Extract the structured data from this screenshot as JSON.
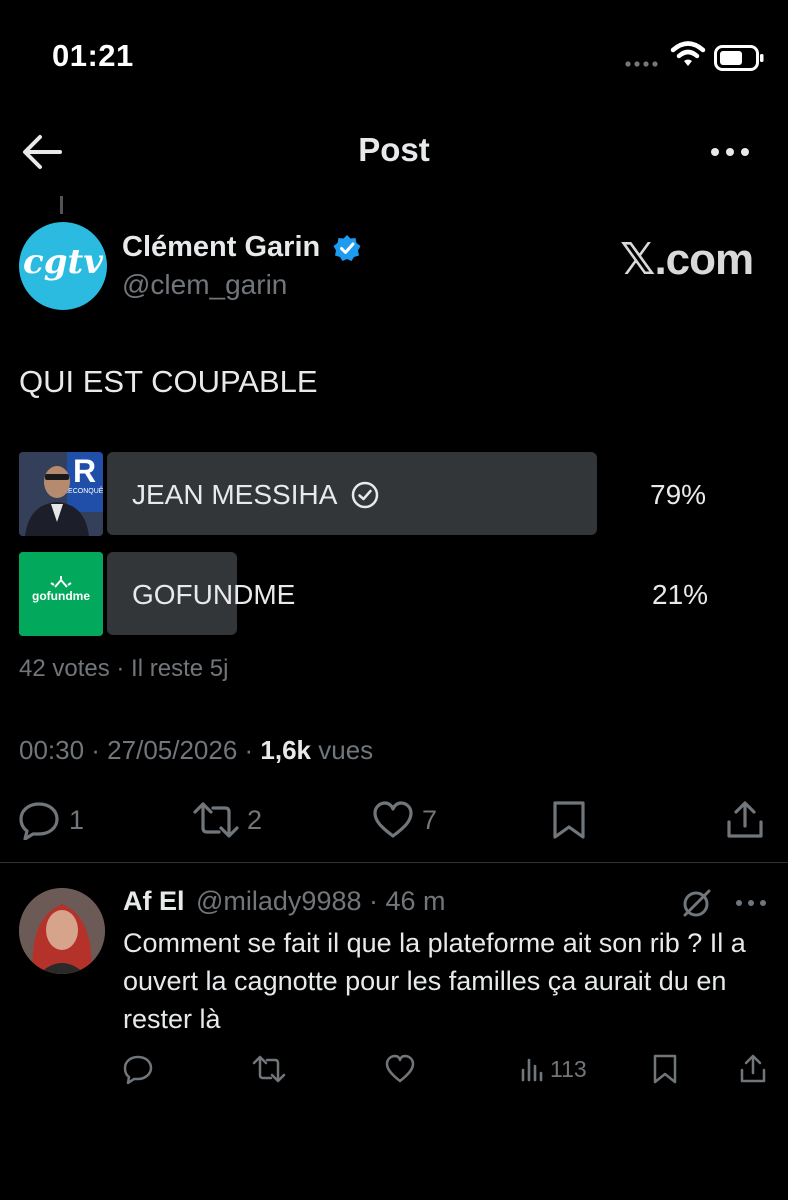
{
  "status_bar": {
    "time": "01:21"
  },
  "nav": {
    "title": "Post"
  },
  "author": {
    "avatar_text": "cgtv",
    "name": "Clément Garin",
    "handle": "@clem_garin",
    "brand": "𝕏.com"
  },
  "post": {
    "text": "QUI EST COUPABLE",
    "poll": {
      "options": [
        {
          "label": "JEAN MESSIHA",
          "percent": "79%",
          "fraction": 0.79,
          "verified": true,
          "image_text": "RECONQUÊ"
        },
        {
          "label": "GOFUNDME",
          "percent": "21%",
          "fraction": 0.21,
          "verified": false,
          "image_text": "gofundme"
        }
      ],
      "meta": "42 votes · Il reste 5j"
    },
    "time": "00:30 · 27/05/2026 · ",
    "views_count": "1,6k",
    "views_label": " vues",
    "actions": {
      "replies": "1",
      "reposts": "2",
      "likes": "7"
    }
  },
  "reply": {
    "name": "Af El",
    "handle": "@milady9988 · 46 m",
    "text": "Comment se fait il que la plateforme ait son rib ? Il a ouvert la cagnotte pour les familles ça aurait du en rester là",
    "views": "113"
  },
  "colors": {
    "accent": "#1d9bf0",
    "secondary_text": "#71767b",
    "bar": "#333639",
    "gofundme": "#02a95c"
  }
}
